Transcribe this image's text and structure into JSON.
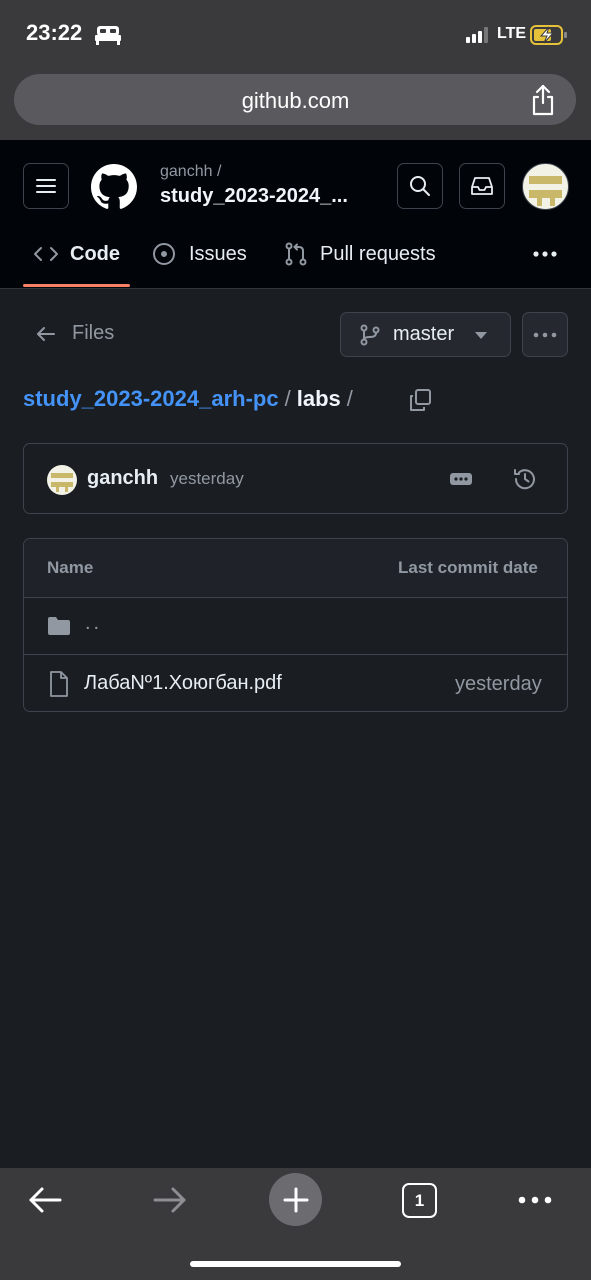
{
  "status_bar": {
    "time": "23:22",
    "network": "LTE"
  },
  "browser": {
    "url": "github.com",
    "tab_count": "1"
  },
  "repo_header": {
    "owner": "ganchh /",
    "repo": "study_2023-2024_..."
  },
  "tabs": [
    {
      "label": "Code",
      "active": true
    },
    {
      "label": "Issues",
      "active": false
    },
    {
      "label": "Pull requests",
      "active": false
    }
  ],
  "file_nav": {
    "back_label": "Files",
    "branch": "master"
  },
  "breadcrumb": {
    "repo_link": "study_2023-2024_arh-pc",
    "sep1": "/",
    "current": "labs",
    "sep2": "/"
  },
  "latest_commit": {
    "author": "ganchh",
    "time": "yesterday"
  },
  "file_table": {
    "headers": {
      "name": "Name",
      "date": "Last commit date"
    },
    "parent_dir": "..",
    "files": [
      {
        "name": "ЛабаNº1.Хоюгбан.pdf",
        "date": "yesterday"
      }
    ]
  },
  "colors": {
    "link": "#4493f8",
    "active_tab": "#f78166",
    "background": "#1a1d22"
  }
}
